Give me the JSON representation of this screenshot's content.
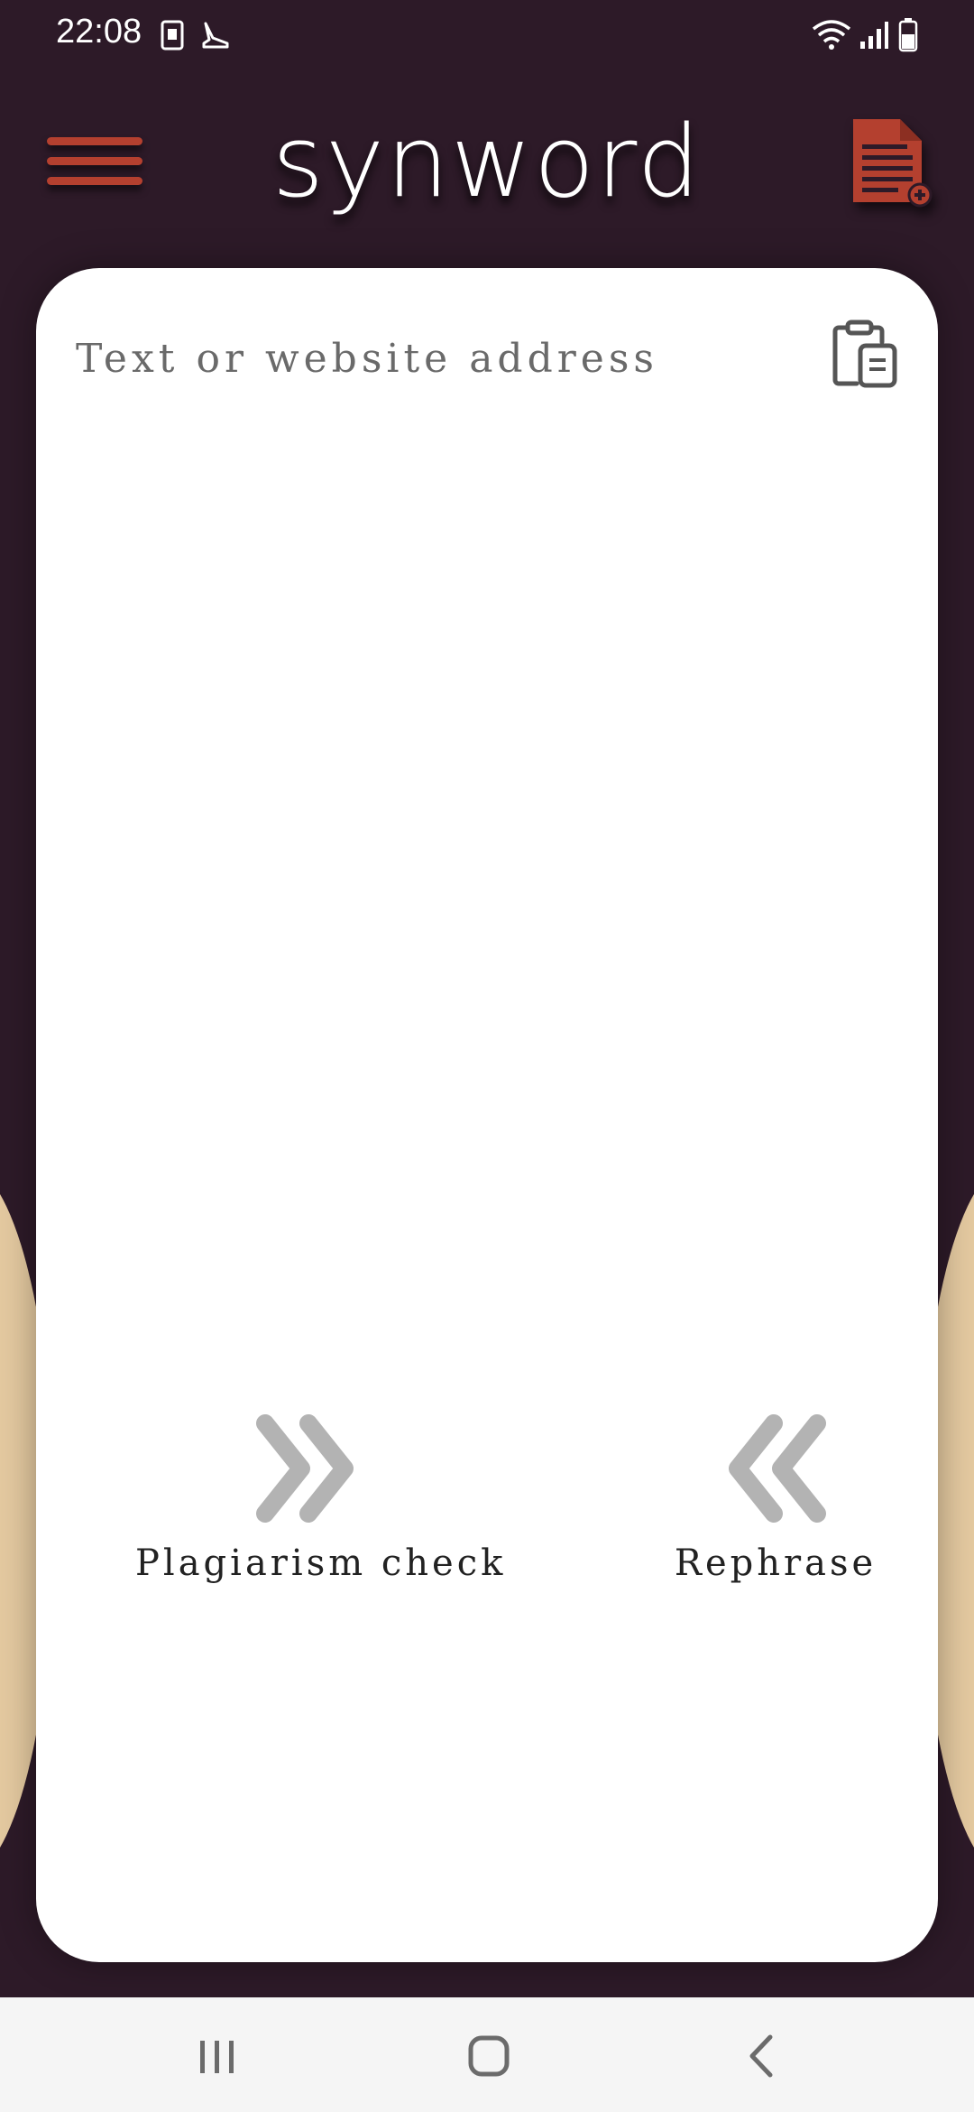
{
  "status_bar": {
    "time": "22:08",
    "icons": [
      "sim-card-icon",
      "shoe-icon",
      "wifi-icon",
      "signal-icon",
      "battery-icon"
    ]
  },
  "header": {
    "title": "synword",
    "menu_icon": "hamburger-menu-icon",
    "new_doc_icon": "new-document-icon",
    "accent_color": "#b4402f"
  },
  "editor": {
    "placeholder": "Text or website address",
    "value": "",
    "paste_icon": "clipboard-paste-icon"
  },
  "actions": {
    "plagiarism_label": "Plagiarism check",
    "plagiarism_icon": "double-chevron-right-icon",
    "rephrase_label": "Rephrase",
    "rephrase_icon": "double-chevron-left-icon"
  },
  "nav_bar": {
    "recents_icon": "recents-icon",
    "home_icon": "home-icon",
    "back_icon": "back-icon"
  },
  "colors": {
    "background": "#2d1a28",
    "card": "#ffffff",
    "side_accent": "#e4c9a0",
    "arrow_gray": "#b3b3b3"
  }
}
